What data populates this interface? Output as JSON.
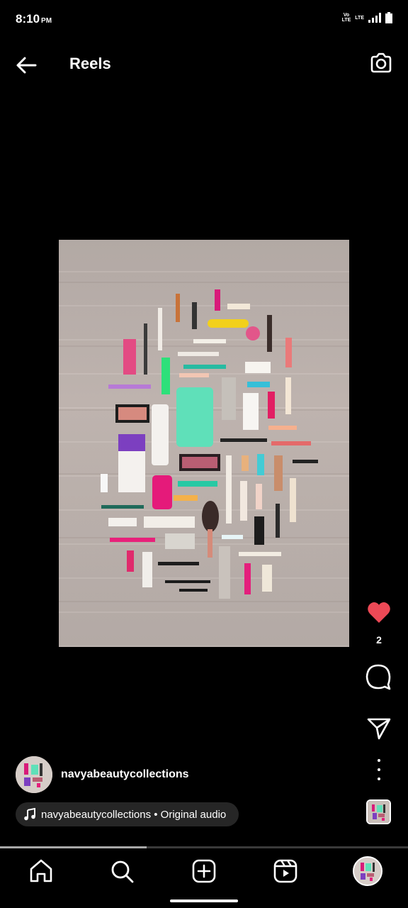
{
  "status": {
    "time": "8:10",
    "ampm": "PM",
    "volte1": "Vo",
    "volte2": "LTE",
    "lte": "LTE"
  },
  "header": {
    "title": "Reels"
  },
  "reel": {
    "likes": "2",
    "username": "navyabeautycollections",
    "audio": "navyabeautycollections • Original audio",
    "progress": 0.36
  },
  "icons": {
    "back": "arrow-left-icon",
    "camera": "camera-icon",
    "like": "heart-icon",
    "comment": "comment-icon",
    "share": "send-icon",
    "more": "more-vertical-icon",
    "music": "music-note-icon",
    "home": "home-icon",
    "search": "search-icon",
    "create": "plus-square-icon",
    "reels": "reels-icon"
  },
  "colors": {
    "like": "#ed4956",
    "background": "#000000",
    "pill": "#262626"
  }
}
